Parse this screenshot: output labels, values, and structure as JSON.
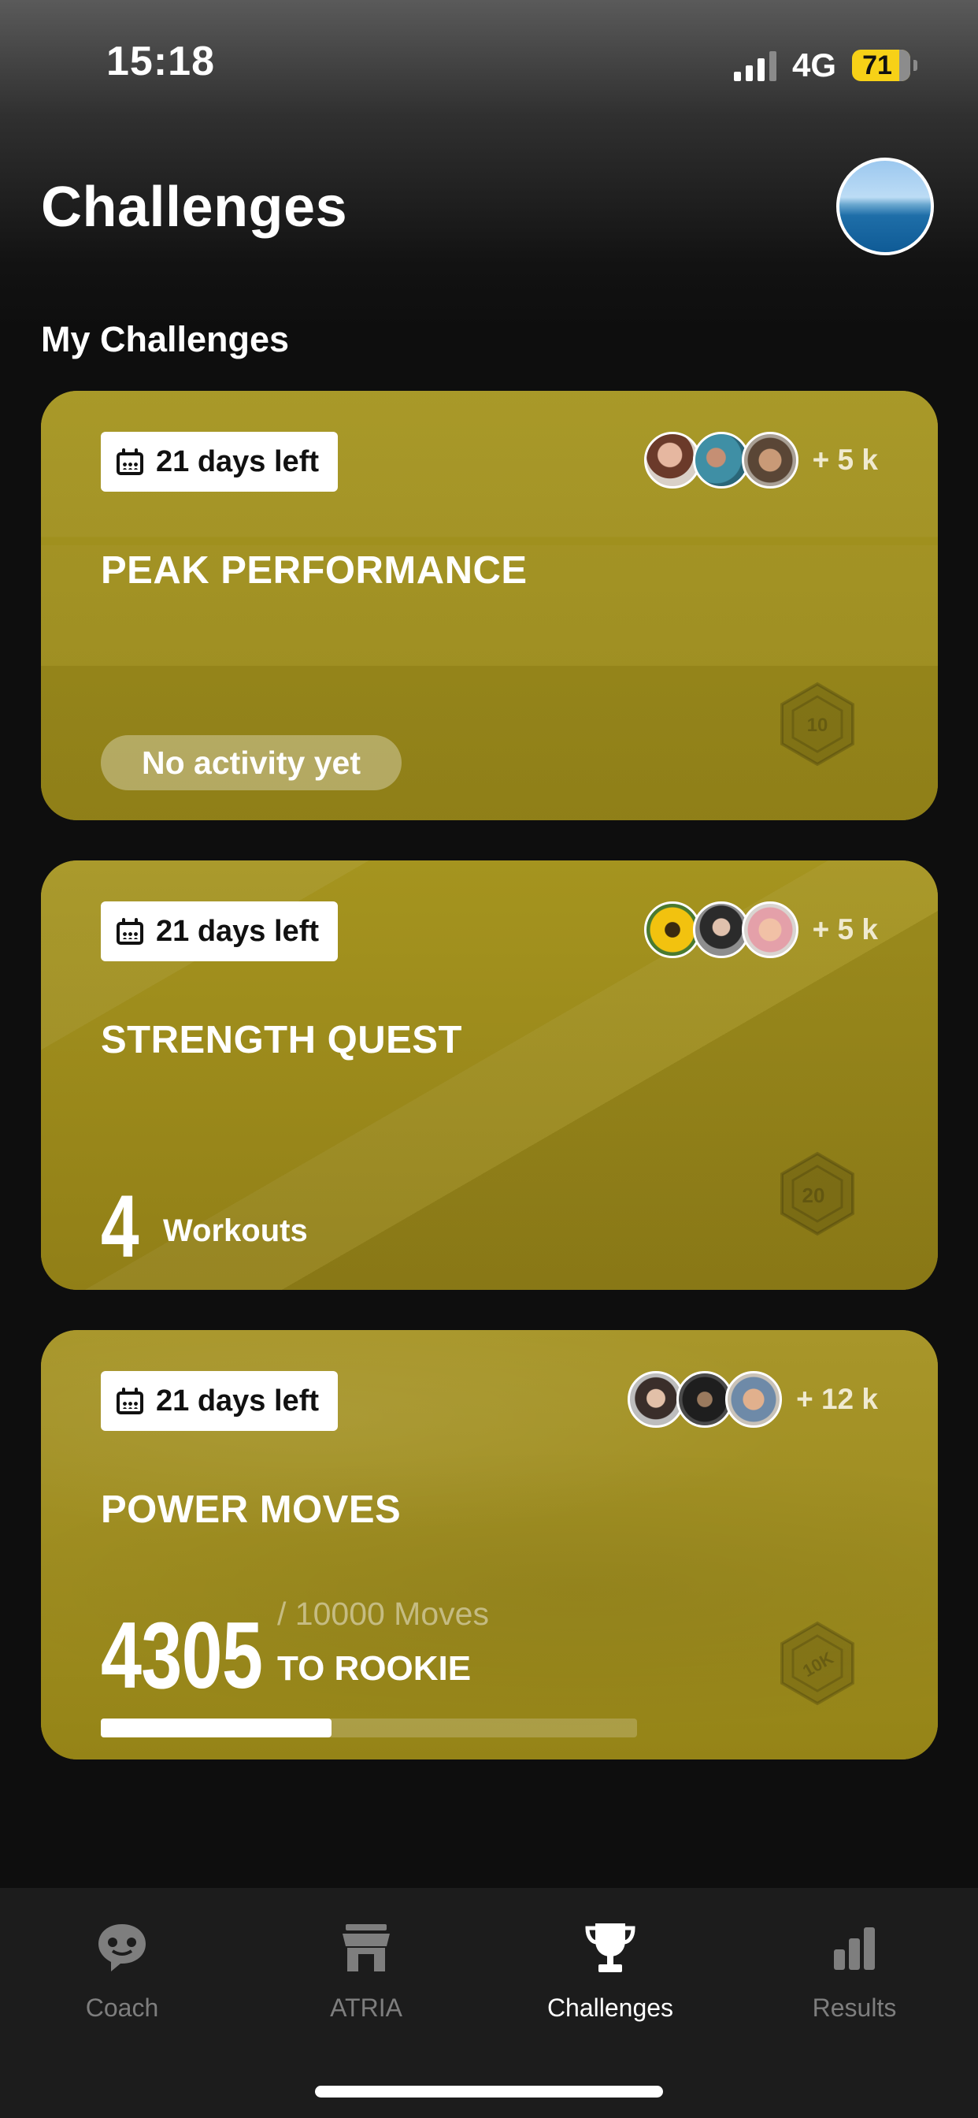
{
  "status_bar": {
    "time": "15:18",
    "network": "4G",
    "battery": "71"
  },
  "header": {
    "title": "Challenges",
    "avatar": "profile-avatar"
  },
  "section": {
    "title": "My Challenges"
  },
  "colors": {
    "card": "#9c8a1c",
    "accent_battery": "#f7d117",
    "tabbar": "#1c1c1c"
  },
  "challenges": [
    {
      "days_left": "21 days left",
      "title": "PEAK PERFORMANCE",
      "participants_extra": "+ 5 k",
      "status": "No activity yet",
      "medal": "10"
    },
    {
      "days_left": "21 days left",
      "title": "STRENGTH QUEST",
      "participants_extra": "+ 5 k",
      "count": "4",
      "unit": "Workouts",
      "medal": "20"
    },
    {
      "days_left": "21 days left",
      "title": "POWER MOVES",
      "participants_extra": "+ 12 k",
      "count": "4305",
      "goal": "/ 10000 Moves",
      "goal_label": "TO ROOKIE",
      "progress": 0.43,
      "medal": "10K"
    }
  ],
  "tabs": [
    {
      "label": "Coach",
      "icon": "coach-bubble-icon",
      "active": false
    },
    {
      "label": "ATRIA",
      "icon": "store-icon",
      "active": false
    },
    {
      "label": "Challenges",
      "icon": "trophy-icon",
      "active": true
    },
    {
      "label": "Results",
      "icon": "bar-chart-icon",
      "active": false
    }
  ]
}
